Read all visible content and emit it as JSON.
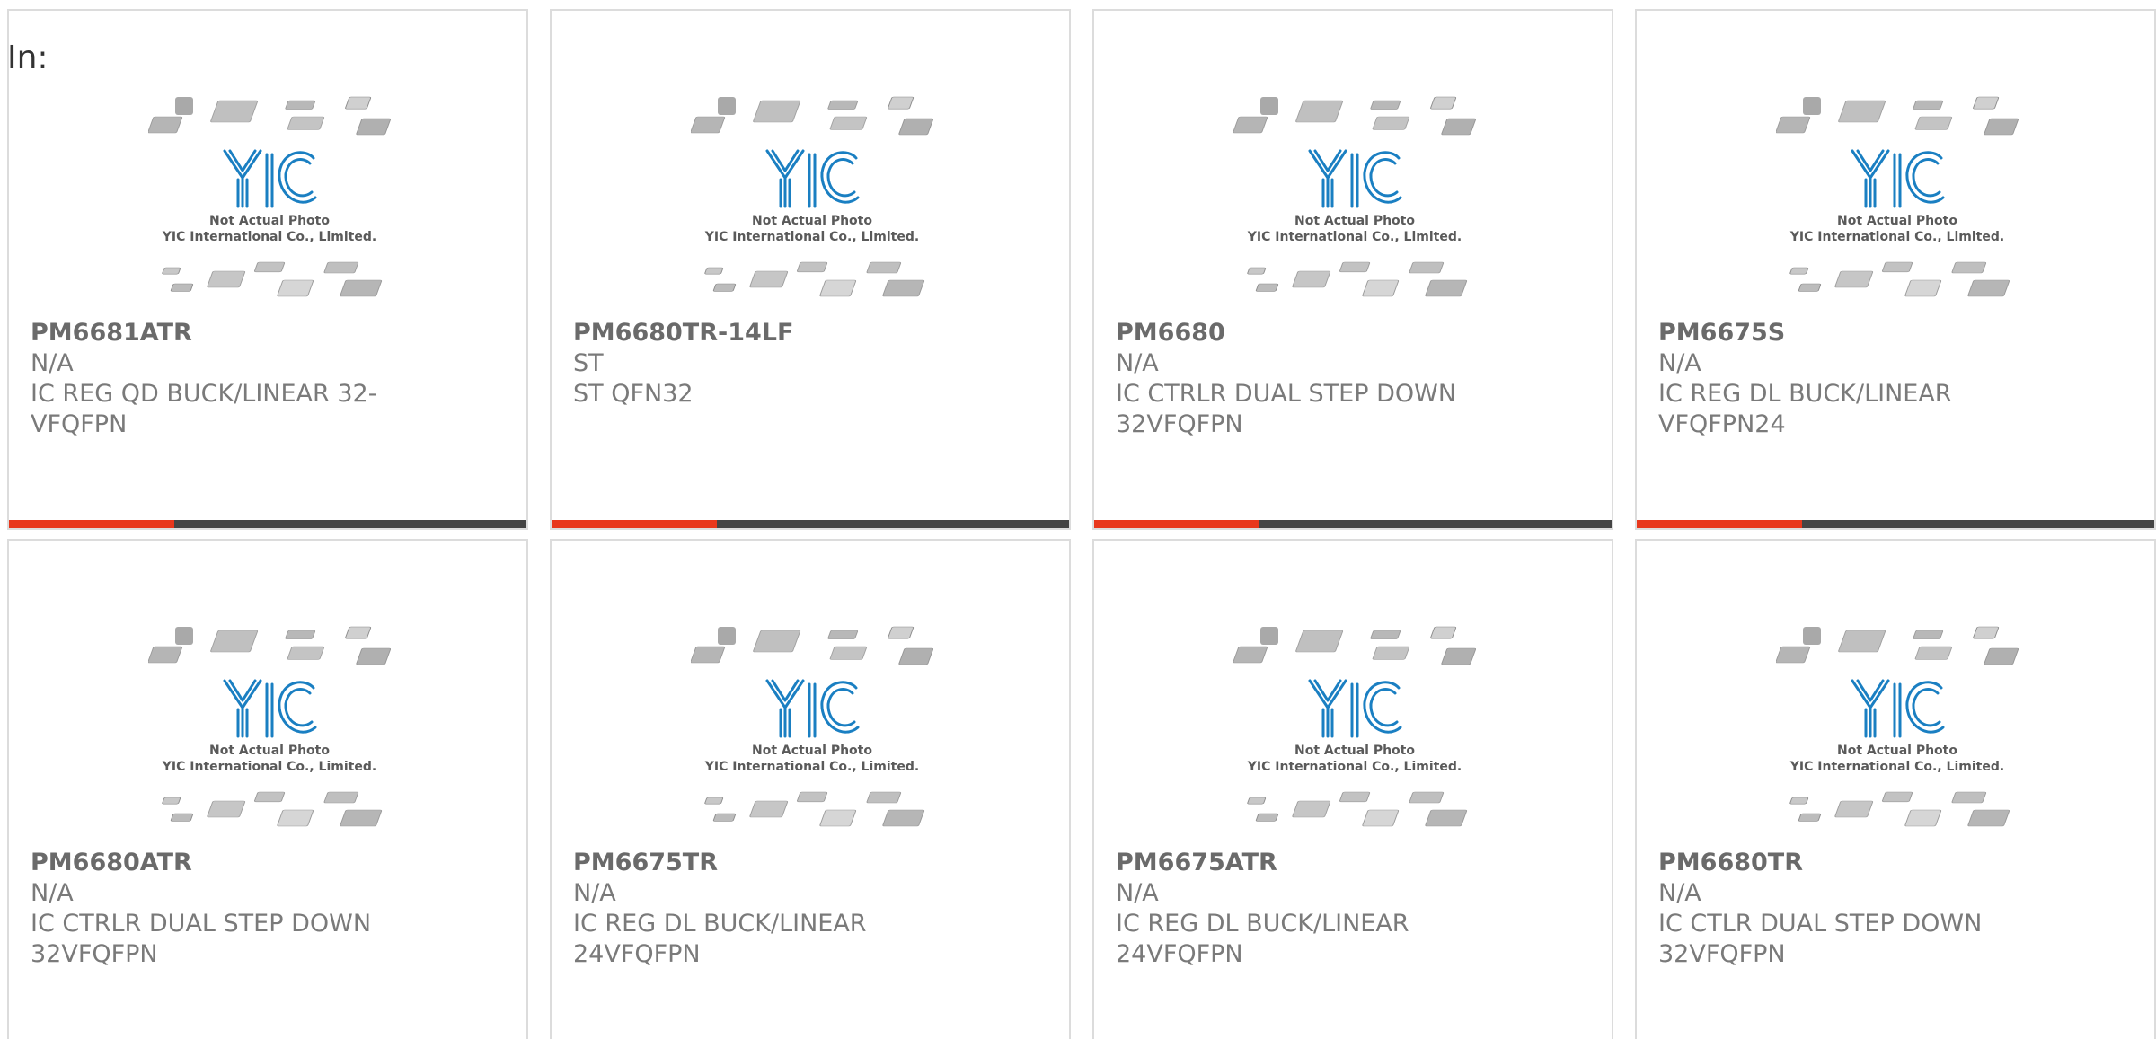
{
  "header": {
    "label": "In:"
  },
  "placeholder_image": {
    "line1": "Not Actual Photo",
    "line2": "YIC International Co., Limited.",
    "logo_text": "YIC",
    "logo_color": "#1a7fc2"
  },
  "colors": {
    "accent": "#e8371c",
    "bar": "#444444",
    "text": "#7a7a7a",
    "border": "#dcdcdc"
  },
  "products": [
    {
      "part": "PM6681ATR",
      "manufacturer": "N/A",
      "description": "IC REG QD BUCK/LINEAR 32-VFQFPN",
      "progress": 0.32
    },
    {
      "part": "PM6680TR-14LF",
      "manufacturer": "ST",
      "description": "ST QFN32",
      "progress": 0.32
    },
    {
      "part": "PM6680",
      "manufacturer": "N/A",
      "description": "IC CTRLR DUAL STEP DOWN 32VFQFPN",
      "progress": 0.32
    },
    {
      "part": "PM6675S",
      "manufacturer": "N/A",
      "description": "IC REG DL BUCK/LINEAR VFQFPN24",
      "progress": 0.32
    },
    {
      "part": "PM6680ATR",
      "manufacturer": "N/A",
      "description": "IC CTRLR DUAL STEP DOWN 32VFQFPN"
    },
    {
      "part": "PM6675TR",
      "manufacturer": "N/A",
      "description": "IC REG DL BUCK/LINEAR 24VFQFPN"
    },
    {
      "part": "PM6675ATR",
      "manufacturer": "N/A",
      "description": "IC REG DL BUCK/LINEAR 24VFQFPN"
    },
    {
      "part": "PM6680TR",
      "manufacturer": "N/A",
      "description": "IC CTLR DUAL STEP DOWN 32VFQFPN"
    }
  ]
}
